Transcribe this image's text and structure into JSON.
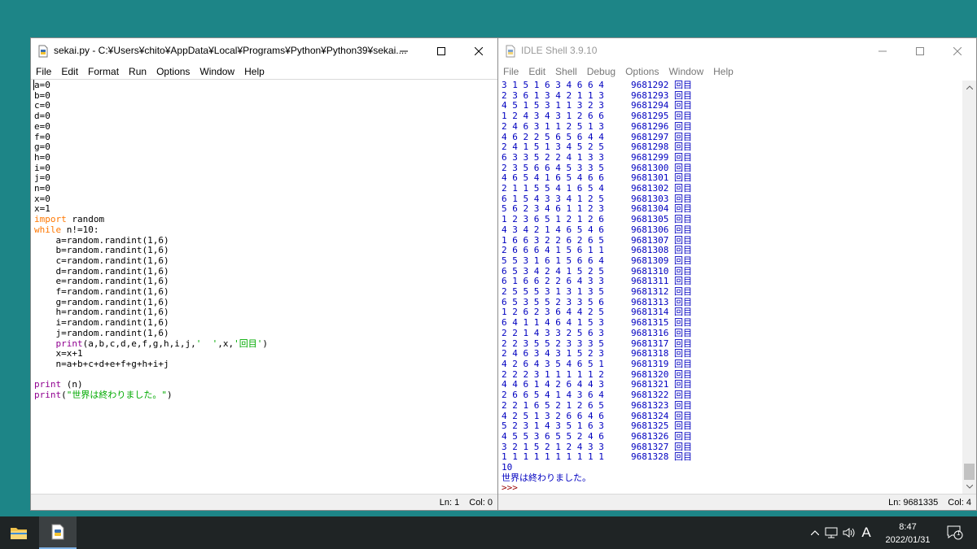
{
  "editor": {
    "title": "sekai.py - C:¥Users¥chito¥AppData¥Local¥Programs¥Python¥Python39¥sekai....",
    "menu": [
      "File",
      "Edit",
      "Format",
      "Run",
      "Options",
      "Window",
      "Help"
    ],
    "status": {
      "ln": "Ln: 1",
      "col": "Col: 0"
    }
  },
  "shell": {
    "title": "IDLE Shell 3.9.10",
    "menu": [
      "File",
      "Edit",
      "Shell",
      "Debug",
      "Options",
      "Window",
      "Help"
    ],
    "rows": [
      {
        "dice": "3 1 5 1 6 3 4 6 6 4",
        "count": "9681292"
      },
      {
        "dice": "2 3 6 1 3 4 2 1 1 3",
        "count": "9681293"
      },
      {
        "dice": "4 5 1 5 3 1 1 3 2 3",
        "count": "9681294"
      },
      {
        "dice": "1 2 4 3 4 3 1 2 6 6",
        "count": "9681295"
      },
      {
        "dice": "2 4 6 3 1 1 2 5 1 3",
        "count": "9681296"
      },
      {
        "dice": "4 6 2 2 5 6 5 6 4 4",
        "count": "9681297"
      },
      {
        "dice": "2 4 1 5 1 3 4 5 2 5",
        "count": "9681298"
      },
      {
        "dice": "6 3 3 5 2 2 4 1 3 3",
        "count": "9681299"
      },
      {
        "dice": "2 3 5 6 6 4 5 3 3 5",
        "count": "9681300"
      },
      {
        "dice": "4 6 5 4 1 6 5 4 6 6",
        "count": "9681301"
      },
      {
        "dice": "2 1 1 5 5 4 1 6 5 4",
        "count": "9681302"
      },
      {
        "dice": "6 1 5 4 3 3 4 1 2 5",
        "count": "9681303"
      },
      {
        "dice": "5 6 2 3 4 6 1 1 2 3",
        "count": "9681304"
      },
      {
        "dice": "1 2 3 6 5 1 2 1 2 6",
        "count": "9681305"
      },
      {
        "dice": "4 3 4 2 1 4 6 5 4 6",
        "count": "9681306"
      },
      {
        "dice": "1 6 6 3 2 2 6 2 6 5",
        "count": "9681307"
      },
      {
        "dice": "2 6 6 6 4 1 5 6 1 1",
        "count": "9681308"
      },
      {
        "dice": "5 5 3 1 6 1 5 6 6 4",
        "count": "9681309"
      },
      {
        "dice": "6 5 3 4 2 4 1 5 2 5",
        "count": "9681310"
      },
      {
        "dice": "6 1 6 6 2 2 6 4 3 3",
        "count": "9681311"
      },
      {
        "dice": "2 5 5 5 3 1 3 1 3 5",
        "count": "9681312"
      },
      {
        "dice": "6 5 3 5 5 2 3 3 5 6",
        "count": "9681313"
      },
      {
        "dice": "1 2 6 2 3 6 4 4 2 5",
        "count": "9681314"
      },
      {
        "dice": "6 4 1 1 4 6 4 1 5 3",
        "count": "9681315"
      },
      {
        "dice": "2 2 1 4 3 3 2 5 6 3",
        "count": "9681316"
      },
      {
        "dice": "2 2 3 5 5 2 3 3 3 5",
        "count": "9681317"
      },
      {
        "dice": "2 4 6 3 4 3 1 5 2 3",
        "count": "9681318"
      },
      {
        "dice": "4 2 6 4 3 5 4 6 5 1",
        "count": "9681319"
      },
      {
        "dice": "2 2 2 3 1 1 1 1 1 2",
        "count": "9681320"
      },
      {
        "dice": "4 4 6 1 4 2 6 4 4 3",
        "count": "9681321"
      },
      {
        "dice": "2 6 6 5 4 1 4 3 6 4",
        "count": "9681322"
      },
      {
        "dice": "2 2 1 6 5 2 1 2 6 5",
        "count": "9681323"
      },
      {
        "dice": "4 2 5 1 3 2 6 6 4 6",
        "count": "9681324"
      },
      {
        "dice": "5 2 3 1 4 3 5 1 6 3",
        "count": "9681325"
      },
      {
        "dice": "4 5 5 3 6 5 5 2 4 6",
        "count": "9681326"
      },
      {
        "dice": "3 2 1 5 2 1 2 4 3 3",
        "count": "9681327"
      },
      {
        "dice": "1 1 1 1 1 1 1 1 1 1",
        "count": "9681328"
      }
    ],
    "row_suffix": "回目",
    "final_n": "10",
    "end_message": "世界は終わりました。",
    "prompt": ">>>",
    "status": {
      "ln": "Ln: 9681335",
      "col": "Col: 4"
    }
  },
  "taskbar": {
    "time": "8:47",
    "date": "2022/01/31",
    "ime": "A",
    "notification_count": "1"
  },
  "icons": [
    "python-file-icon",
    "idle-shell-icon",
    "minimize-icon",
    "maximize-icon",
    "close-icon",
    "file-explorer-icon",
    "python-idle-icon",
    "chevron-up-icon",
    "network-icon",
    "volume-icon",
    "notification-icon"
  ]
}
